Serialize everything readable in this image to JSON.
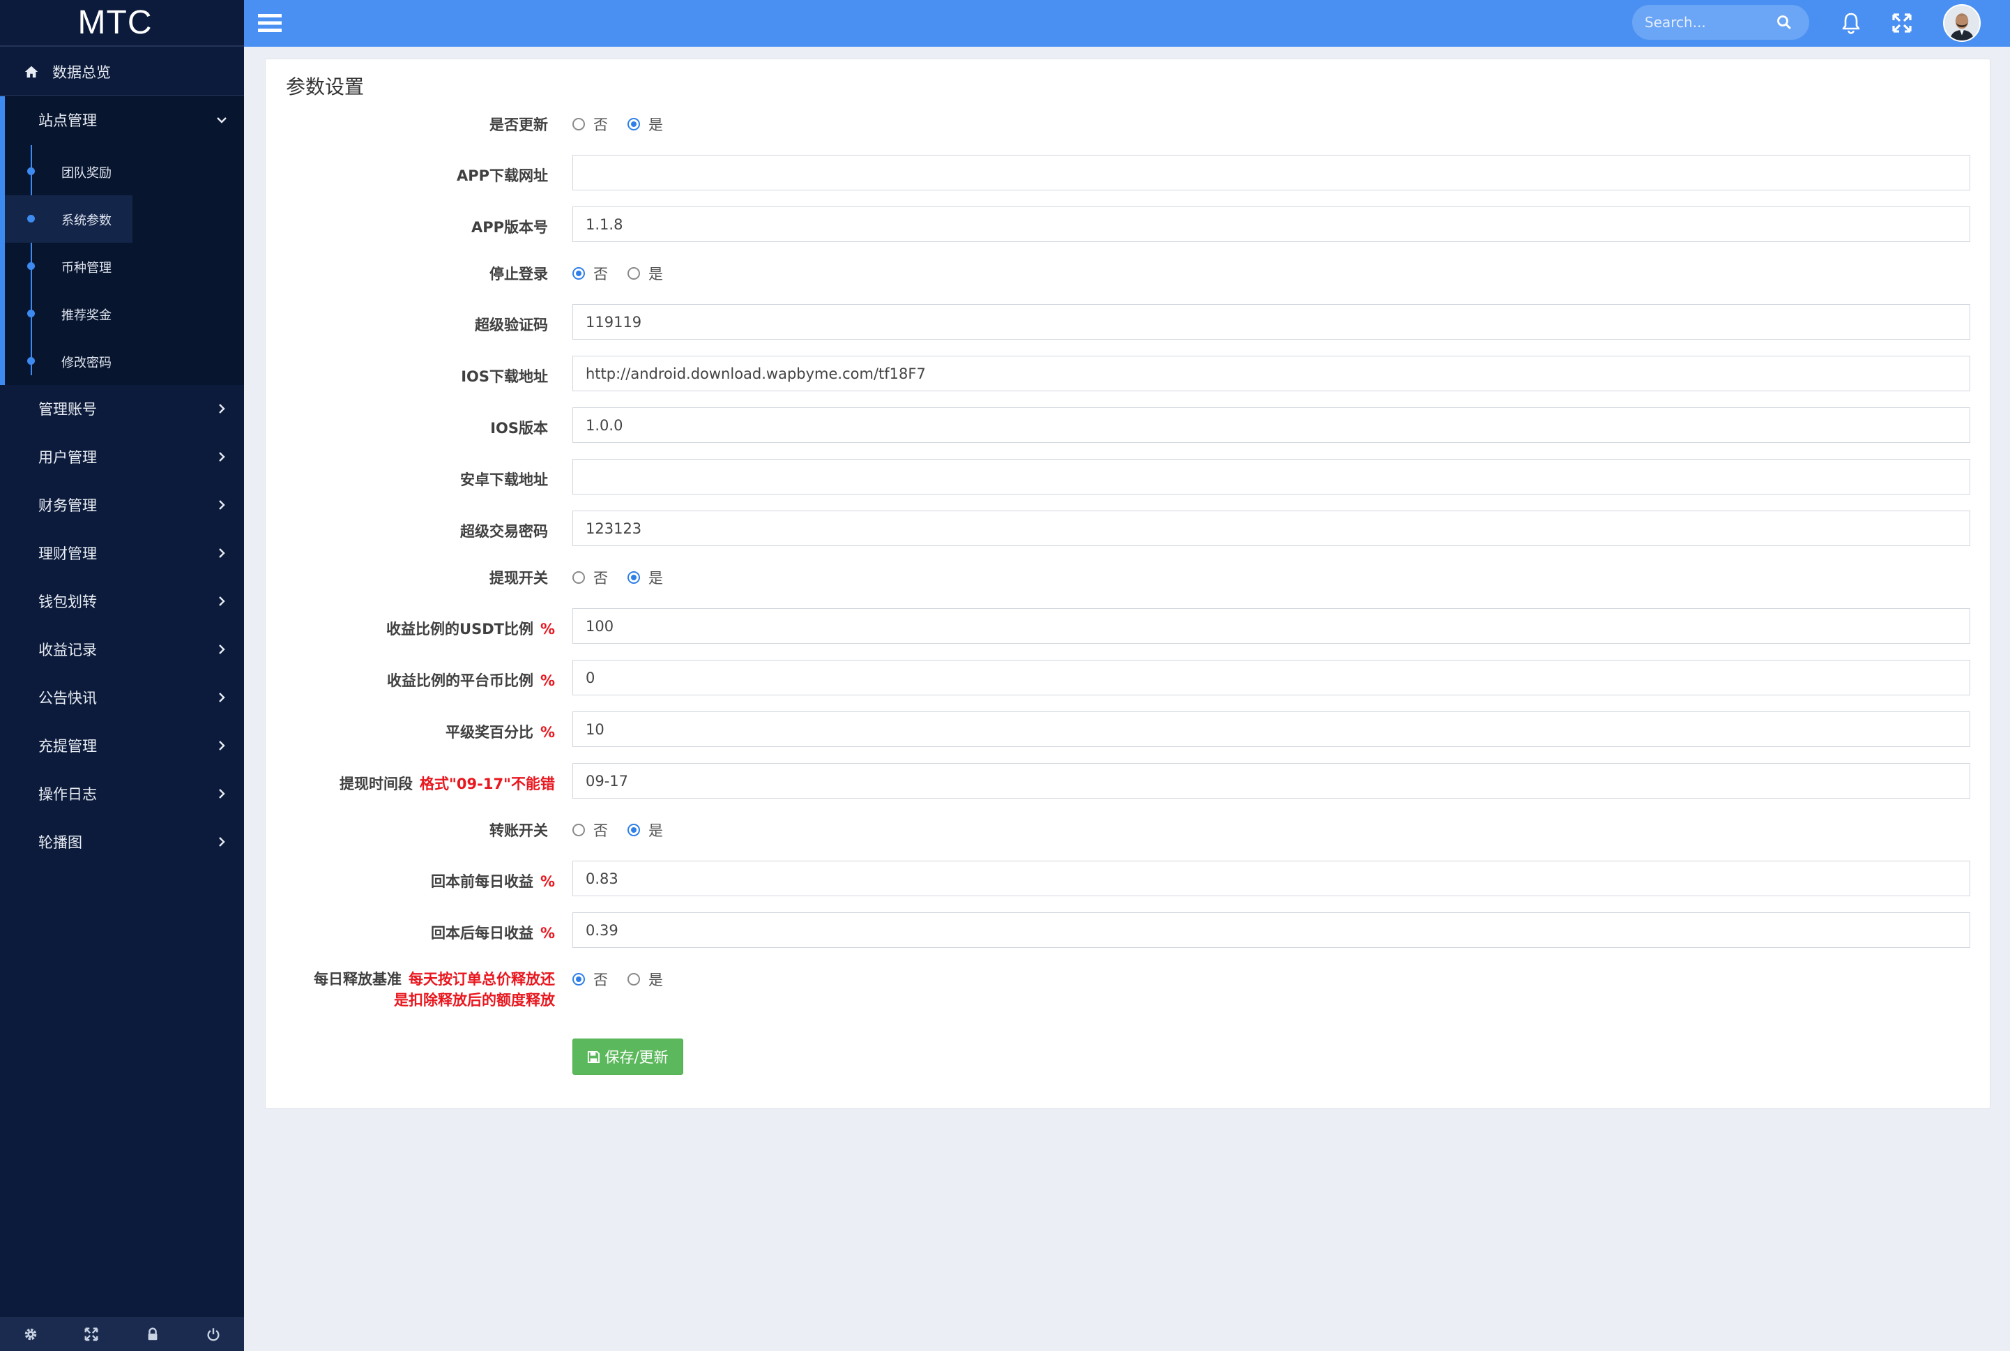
{
  "brand": "MTC",
  "sidebar": {
    "home_label": "数据总览",
    "site_group": {
      "label": "站点管理",
      "children": [
        {
          "label": "团队奖励",
          "active": false
        },
        {
          "label": "系统参数",
          "active": true
        },
        {
          "label": "币种管理",
          "active": false
        },
        {
          "label": "推荐奖金",
          "active": false
        },
        {
          "label": "修改密码",
          "active": false
        }
      ]
    },
    "items": [
      {
        "label": "管理账号"
      },
      {
        "label": "用户管理"
      },
      {
        "label": "财务管理"
      },
      {
        "label": "理财管理"
      },
      {
        "label": "钱包划转"
      },
      {
        "label": "收益记录"
      },
      {
        "label": "公告快讯"
      },
      {
        "label": "充提管理"
      },
      {
        "label": "操作日志"
      },
      {
        "label": "轮播图"
      }
    ],
    "footer_icons": [
      "gear-icon",
      "expand-icon",
      "lock-icon",
      "power-icon"
    ]
  },
  "topbar": {
    "search_placeholder": "Search...",
    "icons": [
      "menu-icon",
      "search-icon",
      "bell-icon",
      "expand-icon",
      "avatar"
    ]
  },
  "colors": {
    "topbar": "#4a90f2",
    "sidebar": "#0c1b3b",
    "accent": "#3d8bf0",
    "hint": "#e8171f",
    "save_button": "#5cb85c"
  },
  "form": {
    "title": "参数设置",
    "radio_options": {
      "no": "否",
      "yes": "是"
    },
    "fields": [
      {
        "label": "是否更新",
        "type": "radio",
        "value": "是"
      },
      {
        "label": "APP下载网址",
        "type": "text",
        "value": ""
      },
      {
        "label": "APP版本号",
        "type": "text",
        "value": "1.1.8"
      },
      {
        "label": "停止登录",
        "type": "radio",
        "value": "否"
      },
      {
        "label": "超级验证码",
        "type": "text",
        "value": "119119"
      },
      {
        "label": "IOS下载地址",
        "type": "text",
        "value": "http://android.download.wapbyme.com/tf18F7"
      },
      {
        "label": "IOS版本",
        "type": "text",
        "value": "1.0.0"
      },
      {
        "label": "安卓下载地址",
        "type": "text",
        "value": ""
      },
      {
        "label": "超级交易密码",
        "type": "text",
        "value": "123123"
      },
      {
        "label": "提现开关",
        "type": "radio",
        "value": "是"
      },
      {
        "label": "收益比例的USDT比例",
        "hint": "%",
        "type": "text",
        "value": "100"
      },
      {
        "label": "收益比例的平台币比例",
        "hint": "%",
        "type": "text",
        "value": "0"
      },
      {
        "label": "平级奖百分比",
        "hint": "%",
        "type": "text",
        "value": "10"
      },
      {
        "label": "提现时间段",
        "hint": "格式\"09-17\"不能错",
        "type": "text",
        "value": "09-17"
      },
      {
        "label": "转账开关",
        "type": "radio",
        "value": "是"
      },
      {
        "label": "回本前每日收益",
        "hint": "%",
        "type": "text",
        "value": "0.83"
      },
      {
        "label": "回本后每日收益",
        "hint": "%",
        "type": "text",
        "value": "0.39"
      },
      {
        "label": "每日释放基准",
        "hint": "每天按订单总价释放还",
        "hint2": "是扣除释放后的额度释放",
        "type": "radio",
        "value": "否"
      }
    ],
    "save_label": "保存/更新"
  }
}
